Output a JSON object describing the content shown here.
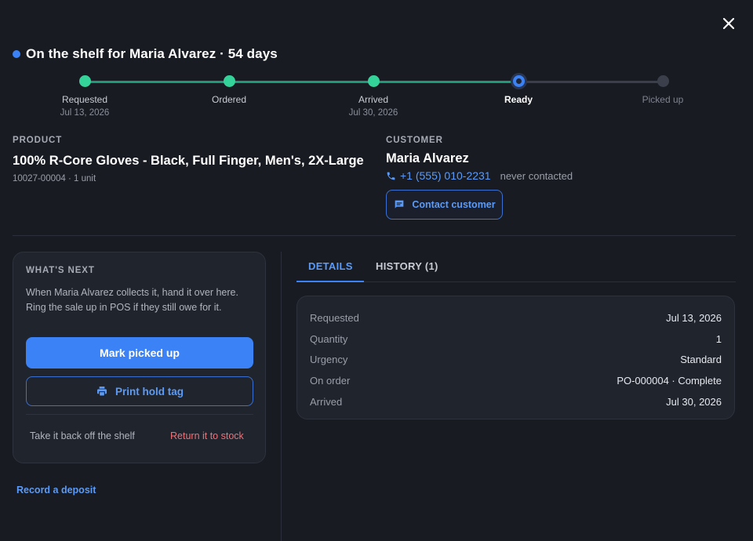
{
  "header": {
    "title": "On the shelf for Maria Alvarez · 54 days",
    "close_label": "close"
  },
  "stepper": [
    {
      "label": "Requested",
      "date": "Jul 13, 2026",
      "state": "done"
    },
    {
      "label": "Ordered",
      "date": "",
      "state": "done"
    },
    {
      "label": "Arrived",
      "date": "Jul 30, 2026",
      "state": "done"
    },
    {
      "label": "Ready",
      "date": "",
      "state": "current"
    },
    {
      "label": "Picked up",
      "date": "",
      "state": "todo"
    }
  ],
  "product": {
    "section_label": "PRODUCT",
    "name": "100% R-Core Gloves - Black, Full Finger, Men's, 2X-Large",
    "meta": "10027-00004 · 1 unit"
  },
  "customer": {
    "section_label": "CUSTOMER",
    "name": "Maria Alvarez",
    "phone": "+1 (555) 010-2231",
    "contact_status": "never contacted",
    "contact_button": "Contact customer"
  },
  "next": {
    "section_label": "WHAT'S NEXT",
    "text": "When Maria Alvarez collects it, hand it over here. Ring the sale up in POS if they still owe for it.",
    "primary_button": "Mark picked up",
    "secondary_button": "Print hold tag",
    "back_off_text": "Take it back off the shelf",
    "return_link": "Return it to stock"
  },
  "record_deposit": "Record a deposit",
  "tabs": [
    {
      "label": "DETAILS",
      "active": true
    },
    {
      "label": "HISTORY (1)",
      "active": false
    }
  ],
  "details": [
    {
      "label": "Requested",
      "value": "Jul 13, 2026"
    },
    {
      "label": "Quantity",
      "value": "1"
    },
    {
      "label": "Urgency",
      "value": "Standard"
    },
    {
      "label": "On order",
      "value": "PO-000004 · Complete"
    },
    {
      "label": "Arrived",
      "value": "Jul 30, 2026"
    }
  ],
  "colors": {
    "accent": "#3b82f6",
    "success": "#34d399",
    "danger": "#f07178",
    "background": "#181b22"
  },
  "icons": {
    "close": "close-icon",
    "phone": "phone-icon",
    "chat": "chat-icon",
    "printer": "printer-icon"
  }
}
